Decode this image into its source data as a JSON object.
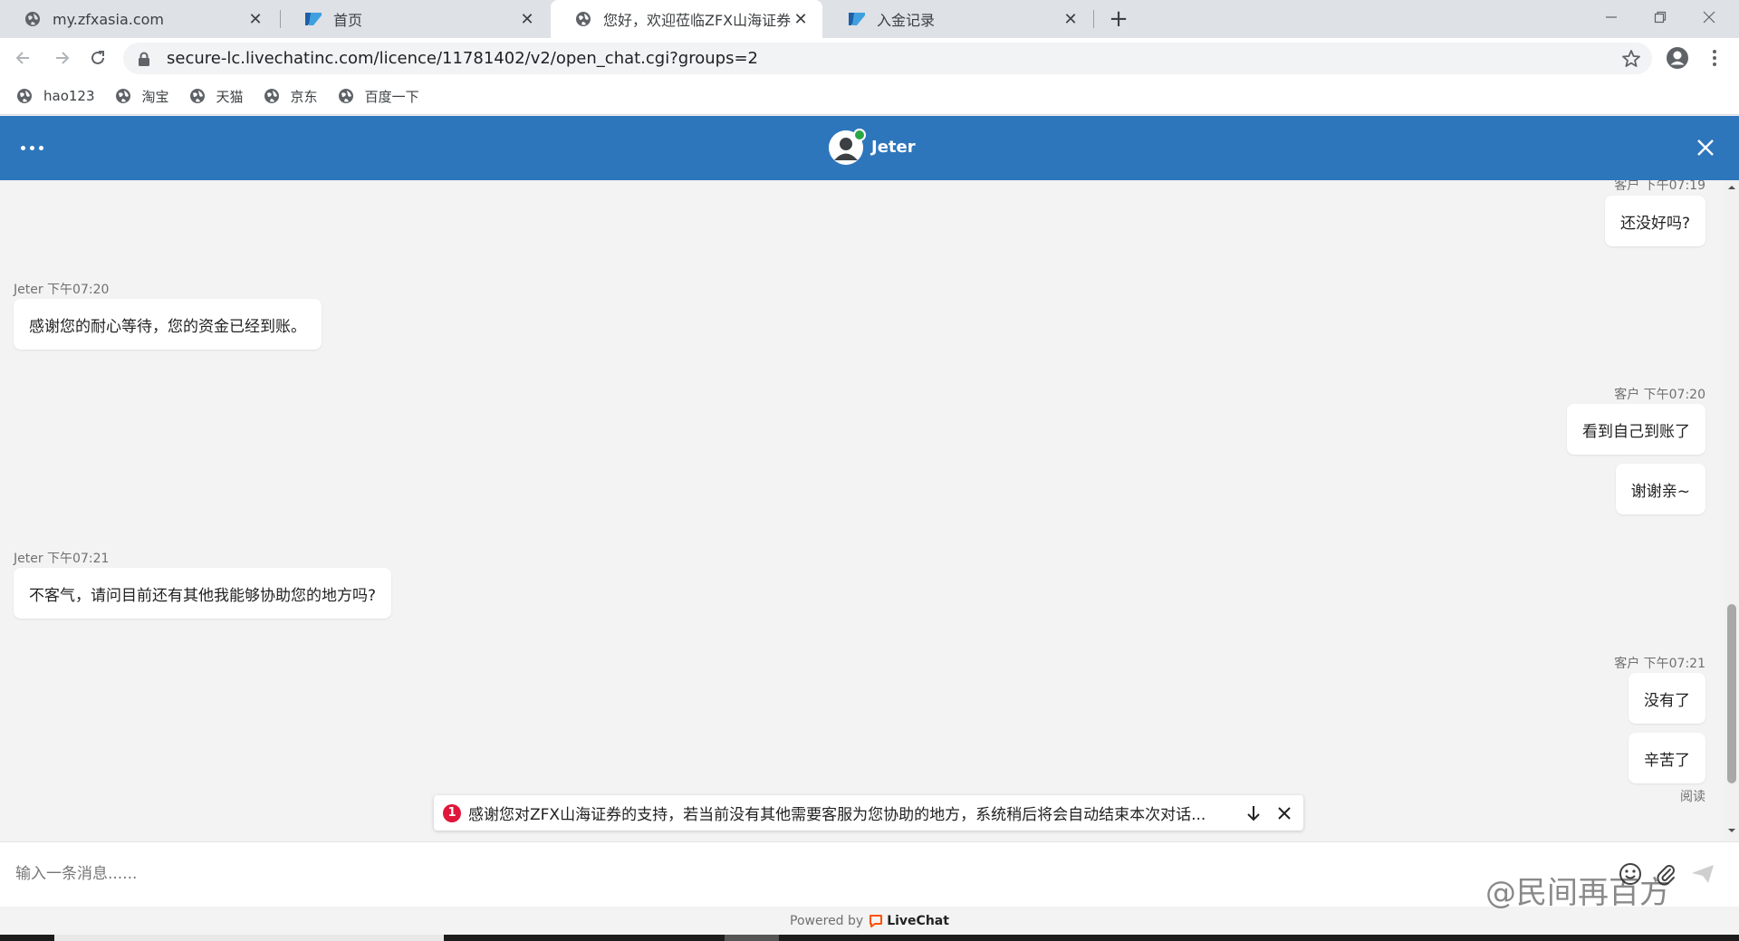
{
  "browser": {
    "tabs": [
      {
        "title": "my.zfxasia.com",
        "icon": "globe-icon",
        "active": false
      },
      {
        "title": "首页",
        "icon": "zfx-logo-icon",
        "active": false
      },
      {
        "title": "您好，欢迎莅临ZFX山海证券。",
        "icon": "globe-icon",
        "active": true
      },
      {
        "title": "入金记录",
        "icon": "zfx-logo-icon",
        "active": false
      }
    ],
    "url": "secure-lc.livechatinc.com/licence/11781402/v2/open_chat.cgi?groups=2",
    "bookmarks": [
      {
        "label": "hao123"
      },
      {
        "label": "淘宝"
      },
      {
        "label": "天猫"
      },
      {
        "label": "京东"
      },
      {
        "label": "百度一下"
      }
    ]
  },
  "chat": {
    "agent_name": "Jeter",
    "agent_status_color": "#28a745",
    "header_color": "#2e76bc",
    "messages": [
      {
        "side": "customer",
        "meta": "客户 下午07:19",
        "bubbles": [
          "还没好吗?"
        ]
      },
      {
        "side": "agent",
        "meta": "Jeter 下午07:20",
        "bubbles": [
          "感谢您的耐心等待，您的资金已经到账。"
        ]
      },
      {
        "side": "customer",
        "meta": "客户 下午07:20",
        "bubbles": [
          "看到自己到账了",
          "谢谢亲~"
        ]
      },
      {
        "side": "agent",
        "meta": "Jeter 下午07:21",
        "bubbles": [
          "不客气，请问目前还有其他我能够协助您的地方吗?"
        ]
      },
      {
        "side": "customer",
        "meta": "客户 下午07:21",
        "bubbles": [
          "没有了",
          "辛苦了"
        ]
      }
    ],
    "read_status": "阅读",
    "notice": {
      "count": "1",
      "text": "感谢您对ZFX山海证券的支持，若当前没有其他需要客服为您协助的地方，系统稍后将会自动结束本次对话..."
    },
    "input_placeholder": "输入一条消息......",
    "footer": {
      "powered_by": "Powered by",
      "brand": "LiveChat",
      "brand_color": "#ff5100"
    }
  },
  "watermark": "@民间再百方"
}
